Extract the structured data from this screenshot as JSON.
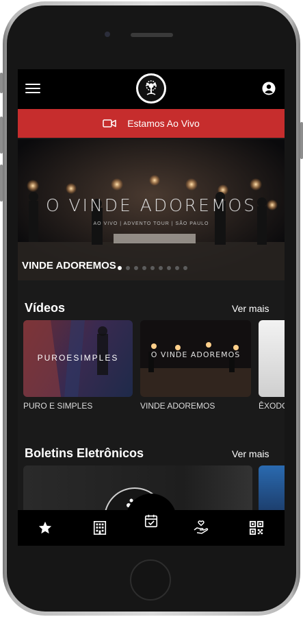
{
  "header": {
    "menu_icon": "hamburger-menu-icon",
    "logo_icon": "tree-logo-icon",
    "user_icon": "user-account-icon"
  },
  "live": {
    "label": "Estamos Ao Vivo",
    "icon": "video-camera-icon",
    "color": "#c62d2d"
  },
  "banner": {
    "image_title": "O VINDE ADOREMOS",
    "image_subtitle": "AO VIVO | ADVENTO TOUR | SÃO PAULO",
    "caption": "VINDE ADOREMOS",
    "slide_count": 9,
    "active_slide": 1
  },
  "videos": {
    "title": "Vídeos",
    "see_more": "Ver mais",
    "items": [
      {
        "label": "PURO E SIMPLES",
        "image_title": "PUROESIMPLES"
      },
      {
        "label": "VINDE ADOREMOS",
        "image_title": "O VINDE ADOREMOS"
      },
      {
        "label": "ÊXODO"
      }
    ]
  },
  "bulletins": {
    "title": "Boletins Eletrônicos",
    "see_more": "Ver mais"
  },
  "bottom_nav": {
    "items": [
      {
        "icon": "star-icon"
      },
      {
        "icon": "building-icon"
      },
      {
        "icon": "calendar-check-icon"
      },
      {
        "icon": "giving-hand-icon"
      },
      {
        "icon": "qr-code-icon"
      }
    ]
  }
}
